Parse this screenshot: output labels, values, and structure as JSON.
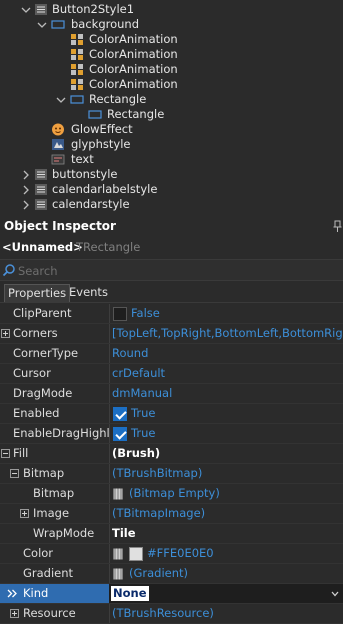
{
  "tree": {
    "items": [
      {
        "label": "Button2Style1"
      },
      {
        "label": "background"
      },
      {
        "label": "ColorAnimation"
      },
      {
        "label": "ColorAnimation"
      },
      {
        "label": "ColorAnimation"
      },
      {
        "label": "ColorAnimation"
      },
      {
        "label": "Rectangle"
      },
      {
        "label": "Rectangle"
      },
      {
        "label": "GlowEffect"
      },
      {
        "label": "glyphstyle"
      },
      {
        "label": "text"
      },
      {
        "label": "buttonstyle"
      },
      {
        "label": "calendarlabelstyle"
      },
      {
        "label": "calendarstyle"
      }
    ]
  },
  "inspector": {
    "title": "Object Inspector",
    "object_name": "<Unnamed>",
    "object_class": "TRectangle",
    "search_placeholder": "Search",
    "tabs": [
      {
        "label": "Properties"
      },
      {
        "label": "Events"
      }
    ]
  },
  "properties": [
    {
      "name": "ClipParent",
      "value": "False"
    },
    {
      "name": "Corners",
      "value": "[TopLeft,TopRight,BottomLeft,BottomRight]"
    },
    {
      "name": "CornerType",
      "value": "Round"
    },
    {
      "name": "Cursor",
      "value": "crDefault"
    },
    {
      "name": "DragMode",
      "value": "dmManual"
    },
    {
      "name": "Enabled",
      "value": "True"
    },
    {
      "name": "EnableDragHighlight",
      "value": "True"
    },
    {
      "name": "Fill",
      "value": "(Brush)"
    },
    {
      "name": "Bitmap",
      "value": "(TBrushBitmap)"
    },
    {
      "name": "Bitmap",
      "value": "(Bitmap Empty)"
    },
    {
      "name": "Image",
      "value": "(TBitmapImage)"
    },
    {
      "name": "WrapMode",
      "value": "Tile"
    },
    {
      "name": "Color",
      "value": "#FFE0E0E0"
    },
    {
      "name": "Gradient",
      "value": "(Gradient)"
    },
    {
      "name": "Kind",
      "value": "None"
    },
    {
      "name": "Resource",
      "value": "(TBrushResource)"
    }
  ],
  "colors": {
    "background": "#2b2b2b",
    "link": "#3d8fd8",
    "selection": "#2f6cb0",
    "color_swatch": "#e0e0e0"
  }
}
